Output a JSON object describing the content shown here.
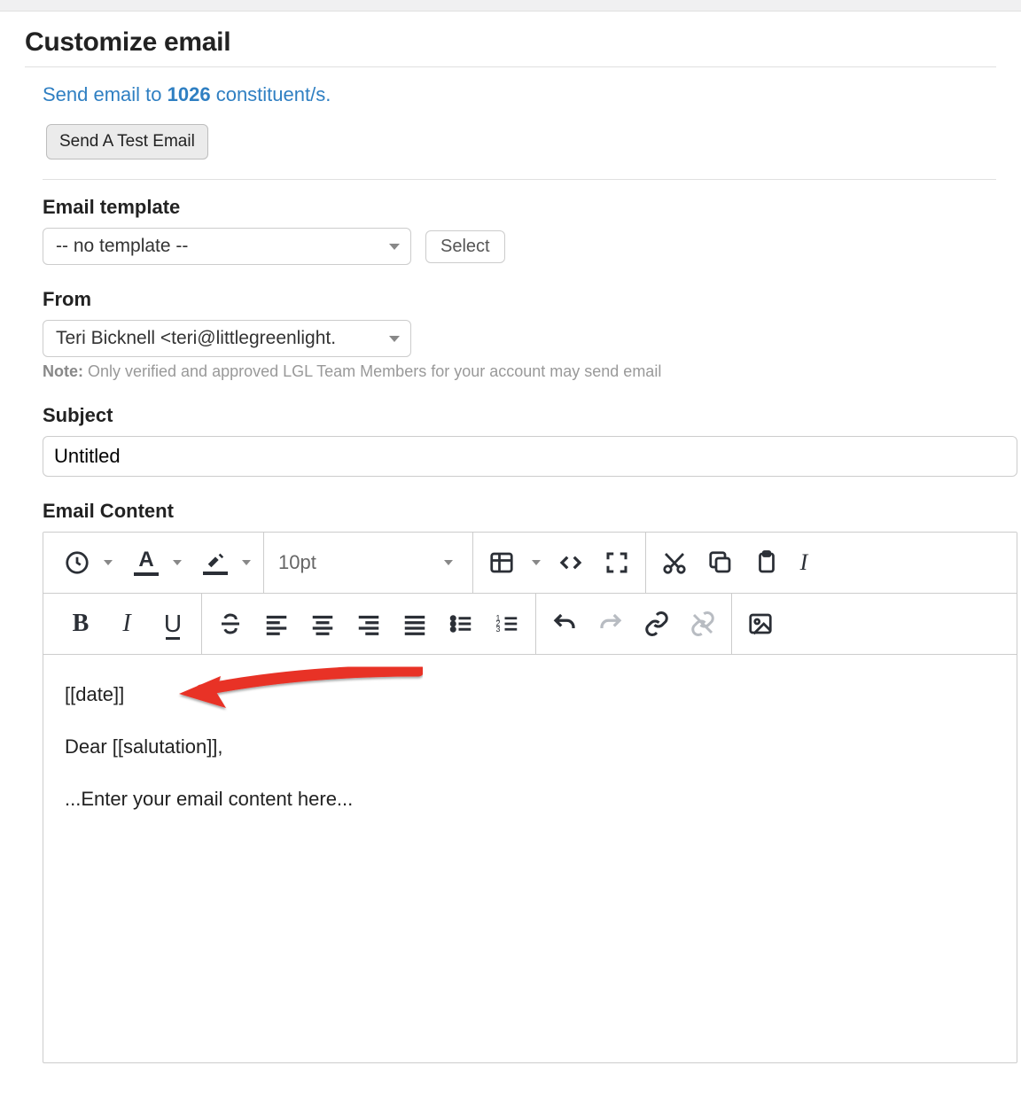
{
  "page": {
    "title": "Customize email"
  },
  "send_link": {
    "prefix": "Send email to ",
    "count": "1026",
    "suffix": " constituent/s."
  },
  "buttons": {
    "send_test": "Send A Test Email",
    "select": "Select"
  },
  "labels": {
    "email_template": "Email template",
    "from": "From",
    "subject": "Subject",
    "email_content": "Email Content",
    "note_prefix": "Note:",
    "note_text": " Only verified and approved LGL Team Members for your account may send email"
  },
  "template_select": {
    "value": "-- no template --"
  },
  "from_select": {
    "value": "Teri Bicknell <teri@littlegreenlight."
  },
  "subject": {
    "value": "Untitled"
  },
  "toolbar": {
    "fontsize": "10pt"
  },
  "content": {
    "line1": "[[date]]",
    "line2": "Dear [[salutation]],",
    "line3": "...Enter your email content here..."
  },
  "colors": {
    "font_underline": "#2b2f36",
    "highlight_underline": "#2b2f36",
    "arrow": "#e83128"
  }
}
